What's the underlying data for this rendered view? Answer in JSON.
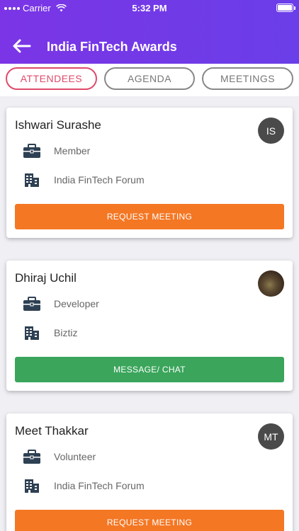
{
  "status_bar": {
    "carrier": "Carrier",
    "time": "5:32 PM"
  },
  "header": {
    "title": "India FinTech Awards"
  },
  "tabs": [
    {
      "label": "ATTENDEES",
      "active": true
    },
    {
      "label": "AGENDA",
      "active": false
    },
    {
      "label": "MEETINGS",
      "active": false
    }
  ],
  "attendees": [
    {
      "name": "Ishwari Surashe",
      "initials": "IS",
      "role": "Member",
      "org": "India FinTech Forum",
      "action": "REQUEST MEETING"
    },
    {
      "name": "Dhiraj Uchil",
      "initials": "",
      "role": "Developer",
      "org": "Biztiz",
      "action": "MESSAGE/ CHAT"
    },
    {
      "name": "Meet Thakkar",
      "initials": "MT",
      "role": "Volunteer",
      "org": "India FinTech Forum",
      "action": "REQUEST MEETING"
    }
  ],
  "colors": {
    "header": "#6a3ee8",
    "active_tab": "#e04a6a",
    "request_button": "#f47724",
    "chat_button": "#3aa55b"
  },
  "icons": {
    "back": "arrow-left-icon",
    "role": "briefcase-icon",
    "org": "building-icon"
  }
}
